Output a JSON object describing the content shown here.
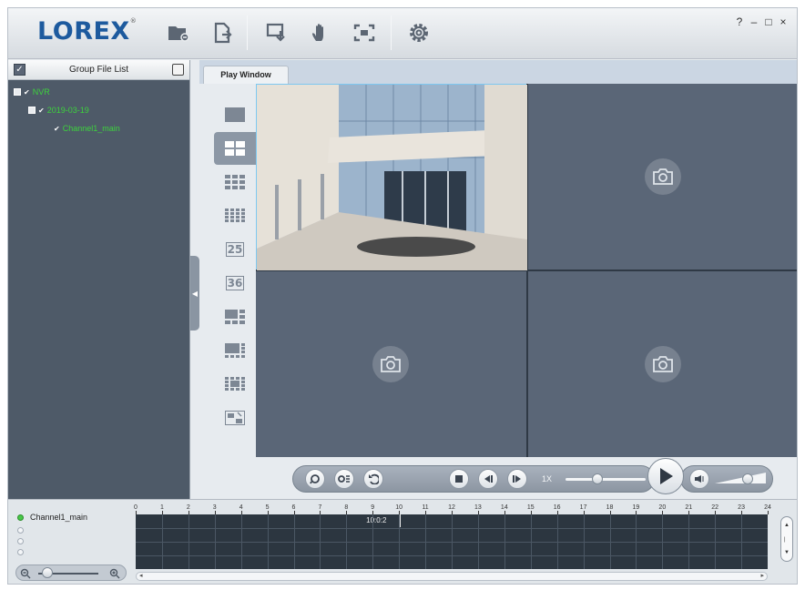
{
  "app": {
    "brand": "LOREX"
  },
  "toolbar": {
    "icons": [
      "open-folder-icon",
      "export-file-icon",
      "clip-download-icon",
      "hand-pan-icon",
      "fullscreen-icon",
      "settings-gear-icon"
    ],
    "help": "?",
    "minimize": "–",
    "maximize": "□",
    "close": "×"
  },
  "left_panel": {
    "title": "Group File List",
    "tree": [
      {
        "label": "NVR",
        "level": 0
      },
      {
        "label": "2019-03-19",
        "level": 1
      },
      {
        "label": "Channel1_main",
        "level": 2
      }
    ]
  },
  "tabs": [
    {
      "label": "Play Window",
      "active": true
    }
  ],
  "layouts": [
    {
      "name": "1",
      "active": false
    },
    {
      "name": "4",
      "active": true
    },
    {
      "name": "9",
      "active": false
    },
    {
      "name": "16",
      "active": false
    },
    {
      "name": "25",
      "active": false,
      "label": "25"
    },
    {
      "name": "36",
      "active": false,
      "label": "36"
    },
    {
      "name": "1+5",
      "active": false
    },
    {
      "name": "1+7",
      "active": false
    },
    {
      "name": "1+12",
      "active": false
    },
    {
      "name": "custom",
      "active": false
    }
  ],
  "video_grid": {
    "columns": 2,
    "rows": 2,
    "active_cell": 0
  },
  "playback": {
    "speed": "1X",
    "speed_level": 0.4,
    "volume_level": 0.65
  },
  "timeline": {
    "channel": "Channel1_main",
    "hours": [
      "0",
      "1",
      "2",
      "3",
      "4",
      "5",
      "6",
      "7",
      "8",
      "9",
      "10",
      "11",
      "12",
      "13",
      "14",
      "15",
      "16",
      "17",
      "18",
      "19",
      "20",
      "21",
      "22",
      "23",
      "24"
    ],
    "cursor_time": "10:0:2",
    "cursor_hours": 10.0,
    "zoom_level": 0.15
  }
}
